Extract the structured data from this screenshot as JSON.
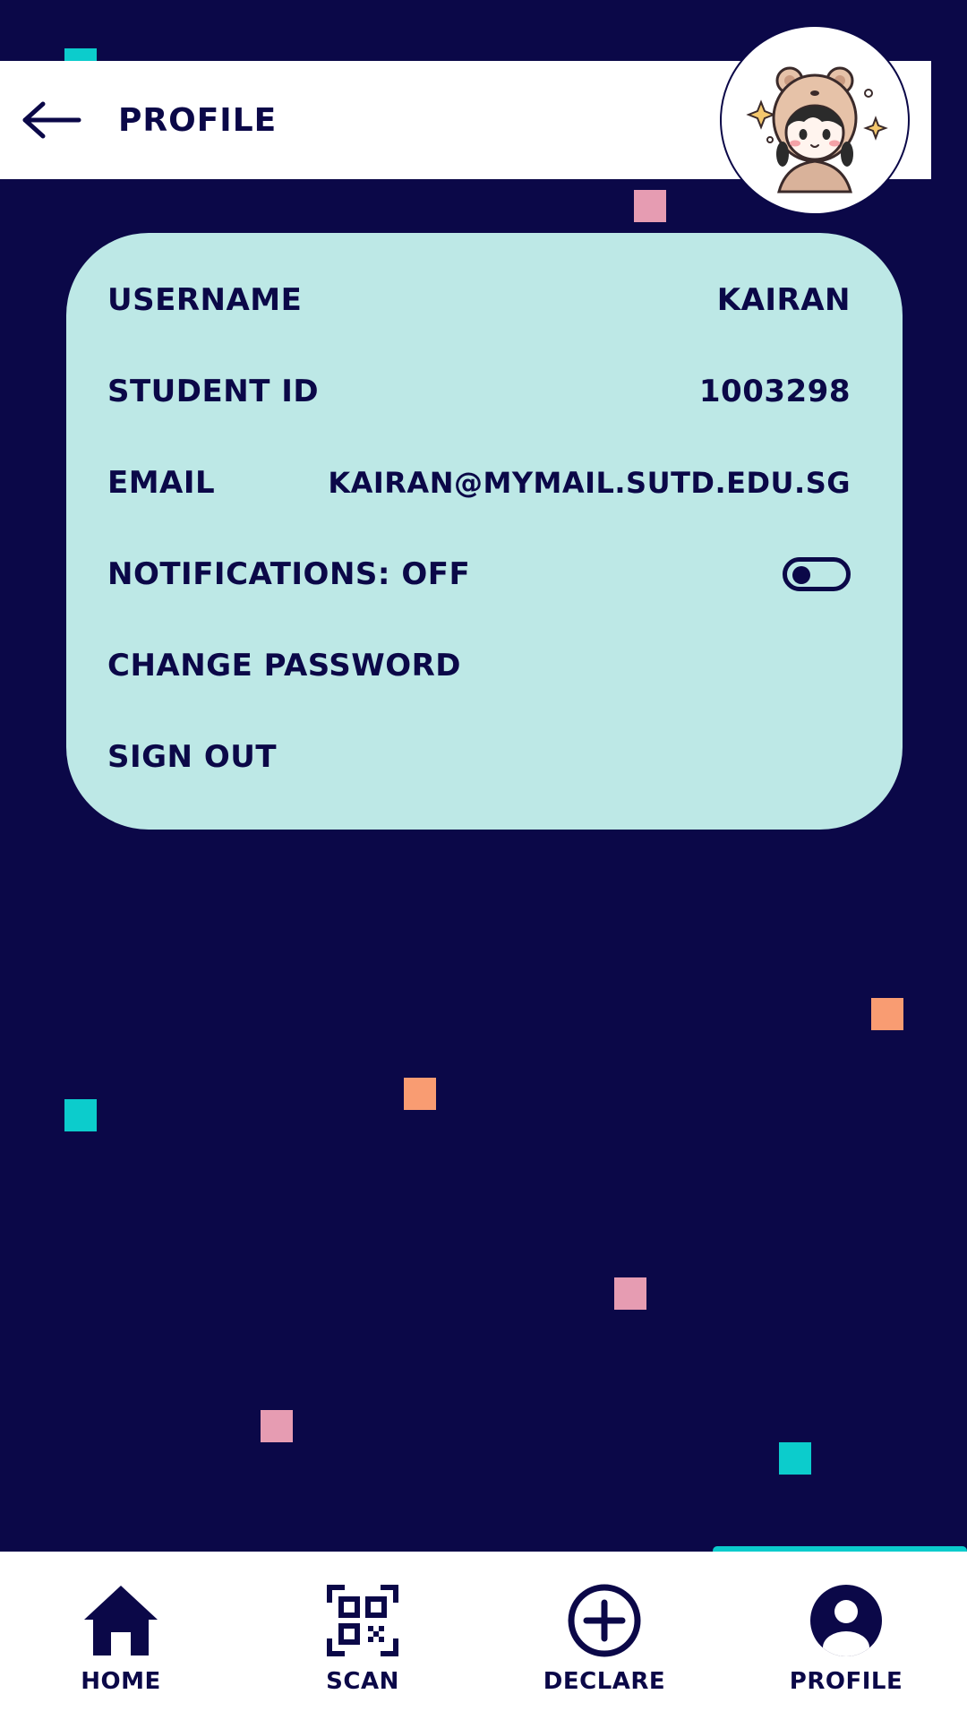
{
  "colors": {
    "background": "#0b0848",
    "card": "#bde8e6",
    "accent": "#0ccccc",
    "confetti_teal": "#0ccccc",
    "confetti_pink": "#e69cb2",
    "confetti_orange": "#f99c72"
  },
  "header": {
    "title": "PROFILE",
    "back_icon": "arrow-left-icon",
    "avatar": "girl-in-bear-hat-avatar"
  },
  "profile": {
    "username_label": "USERNAME",
    "username_value": "KAIRAN",
    "student_id_label": "STUDENT ID",
    "student_id_value": "1003298",
    "email_label": "EMAIL",
    "email_value": "KAIRAN@MYMAIL.SUTD.EDU.SG",
    "notifications_label": "NOTIFICATIONS: OFF",
    "notifications_enabled": false,
    "change_password_label": "CHANGE PASSWORD",
    "sign_out_label": "SIGN OUT"
  },
  "nav": {
    "items": [
      {
        "label": "HOME",
        "icon": "home-icon"
      },
      {
        "label": "SCAN",
        "icon": "qr-scan-icon"
      },
      {
        "label": "DECLARE",
        "icon": "plus-circle-icon"
      },
      {
        "label": "PROFILE",
        "icon": "user-circle-icon"
      }
    ],
    "active": "PROFILE"
  }
}
